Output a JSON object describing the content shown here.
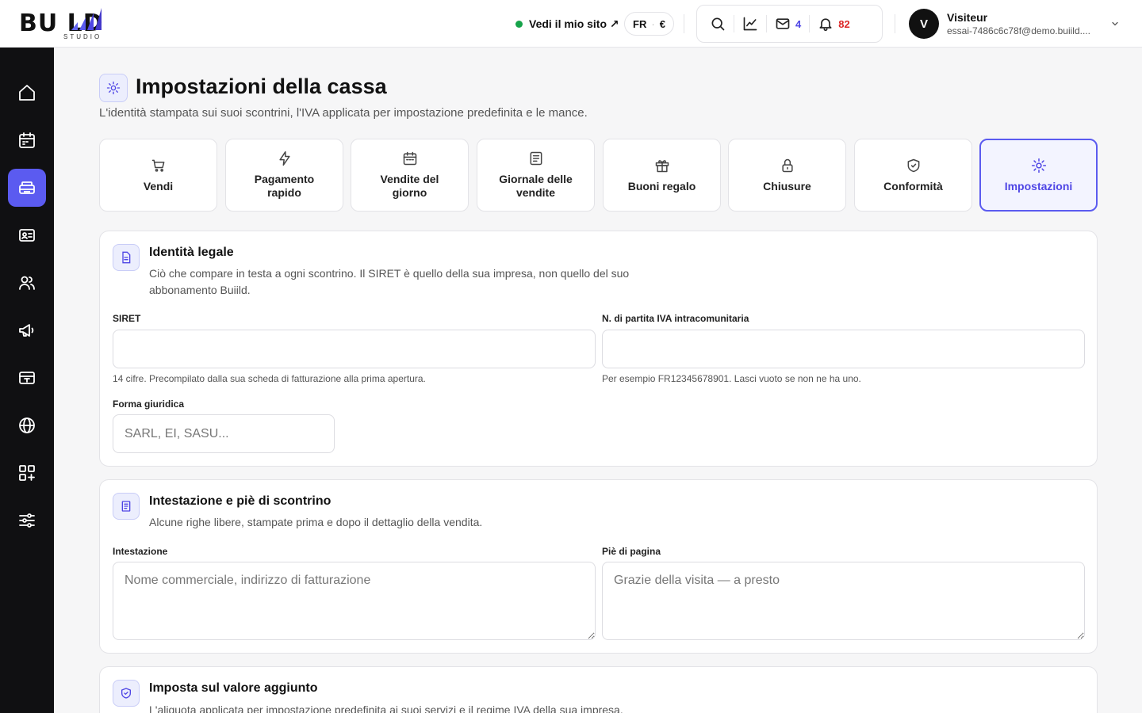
{
  "app": {
    "logo_text": "BU  LD",
    "logo_sub": "STUDIO"
  },
  "header": {
    "site_link": "Vedi il mio sito ↗",
    "lang": "FR",
    "currency": "€",
    "mail_count": "4",
    "notif_count": "82",
    "user_name": "Visiteur",
    "user_email": "essai-7486c6c78f@demo.buiild...."
  },
  "sidebar": {
    "items": [
      "home",
      "calendar",
      "register",
      "contact-card",
      "users",
      "megaphone",
      "payment-card",
      "globe",
      "apps",
      "settings"
    ]
  },
  "page": {
    "title": "Impostazioni della cassa",
    "subtitle": "L'identità stampata sui suoi scontrini, l'IVA applicata per impostazione predefinita e le mance."
  },
  "tabs": [
    {
      "label": "Vendi",
      "icon": "cart-icon"
    },
    {
      "label": "Pagamento rapido",
      "icon": "bolt-icon"
    },
    {
      "label": "Vendite del giorno",
      "icon": "calendar-icon"
    },
    {
      "label": "Giornale delle vendite",
      "icon": "document-icon"
    },
    {
      "label": "Buoni regalo",
      "icon": "gift-icon"
    },
    {
      "label": "Chiusure",
      "icon": "lock-icon"
    },
    {
      "label": "Conformità",
      "icon": "shield-check-icon"
    },
    {
      "label": "Impostazioni",
      "icon": "sun-gear-icon",
      "active": true
    }
  ],
  "legal": {
    "title": "Identità legale",
    "desc": "Ciò che compare in testa a ogni scontrino. Il SIRET è quello della sua impresa, non quello del suo abbonamento Buiild.",
    "siret_label": "SIRET",
    "siret_value": "",
    "siret_hint": "14 cifre. Precompilato dalla sua scheda di fatturazione alla prima apertura.",
    "vat_label": "N. di partita IVA intracomunitaria",
    "vat_value": "",
    "vat_hint": "Per esempio FR12345678901. Lasci vuoto se non ne ha uno.",
    "form_label": "Forma giuridica",
    "form_placeholder": "SARL, EI, SASU..."
  },
  "receipt": {
    "title": "Intestazione e piè di scontrino",
    "desc": "Alcune righe libere, stampate prima e dopo il dettaglio della vendita.",
    "header_label": "Intestazione",
    "header_placeholder": "Nome commerciale, indirizzo di fatturazione",
    "footer_label": "Piè di pagina",
    "footer_placeholder": "Grazie della visita — a presto"
  },
  "vat": {
    "title": "Imposta sul valore aggiunto",
    "desc": "L'aliquota applicata per impostazione predefinita ai suoi servizi e il regime IVA della sua impresa."
  },
  "colors": {
    "accent": "#5b5bf0",
    "accent_text": "#4f46e5",
    "sidebar_bg": "#101012",
    "status_green": "#16a34a",
    "notif_red": "#dc2626"
  }
}
